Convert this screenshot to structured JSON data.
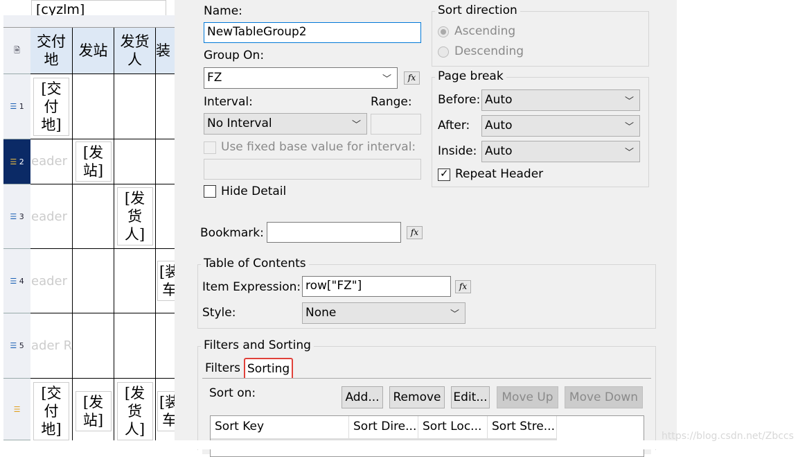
{
  "layout": {
    "top_field": "[cyzlm]",
    "header_cells": [
      "交付地",
      "发站",
      "发货人",
      "装"
    ],
    "row_labels": [
      "1",
      "2",
      "3",
      "4",
      "5"
    ],
    "ghost_text": [
      "eader R",
      "eader R",
      "eader R",
      "ader Ro"
    ],
    "row_cells": [
      "[交付地]",
      "[发站]",
      "[发货人]",
      "[装车"
    ],
    "footer_cells": [
      "[交付地]",
      "[发站]",
      "[发货人]",
      "[装车"
    ]
  },
  "dialog": {
    "name_label": "Name:",
    "name_value": "NewTableGroup2",
    "group_on_label": "Group On:",
    "group_on_value": "FZ",
    "interval_label": "Interval:",
    "interval_value": "No Interval",
    "range_label": "Range:",
    "range_value": "",
    "fixed_base_label": "Use fixed base value for interval:",
    "hide_detail_label": "Hide Detail",
    "sort_direction_title": "Sort direction",
    "ascending": "Ascending",
    "descending": "Descending",
    "page_break_title": "Page break",
    "before_label": "Before:",
    "before_value": "Auto",
    "after_label": "After:",
    "after_value": "Auto",
    "inside_label": "Inside:",
    "inside_value": "Auto",
    "repeat_header_label": "Repeat Header",
    "repeat_header_checked": true,
    "bookmark_label": "Bookmark:",
    "bookmark_value": "",
    "toc_title": "Table of Contents",
    "item_expression_label": "Item Expression:",
    "item_expression_value": "row[\"FZ\"]",
    "style_label": "Style:",
    "style_value": "None",
    "filters_sorting_title": "Filters and Sorting",
    "tabs": [
      "Filters",
      "Sorting"
    ],
    "active_tab": "Sorting",
    "sort_on_label": "Sort on:",
    "buttons": {
      "add": "Add...",
      "remove": "Remove",
      "edit": "Edit...",
      "move_up": "Move Up",
      "move_down": "Move Down"
    },
    "columns": [
      "Sort Key",
      "Sort Dire...",
      "Sort Loc...",
      "Sort Stre..."
    ],
    "fx": "fx"
  },
  "watermark": "https://blog.csdn.net/Zbccs",
  "colors": {
    "highlight": "#e0413a",
    "selected_row": "#0b2a66"
  }
}
